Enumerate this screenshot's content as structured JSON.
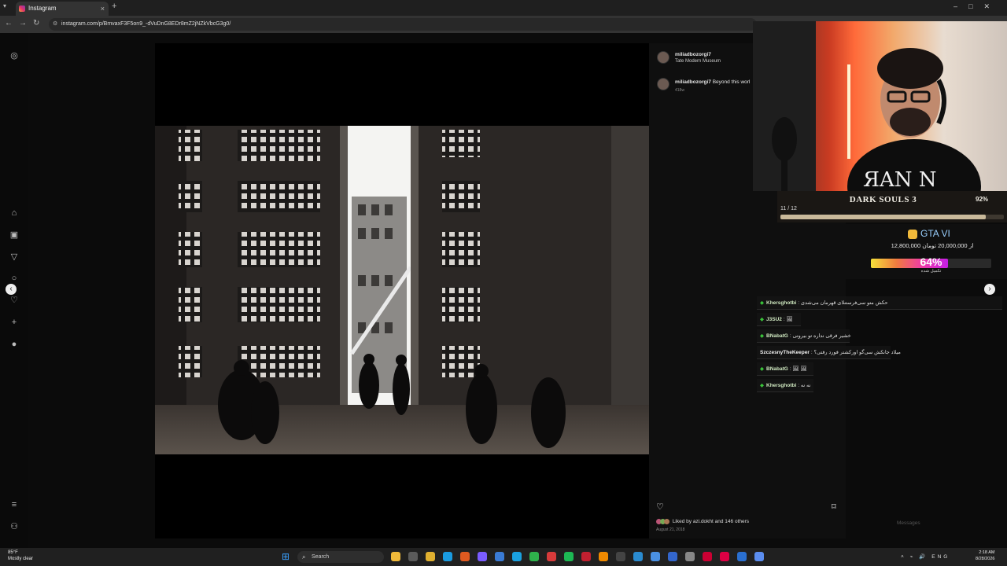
{
  "browser": {
    "tab_title": "Instagram",
    "url": "instagram.com/p/BmvaxF3F5on9_-dVuDnG8EDr8mZ2jNZkVbcG3g0/",
    "new_tab": "+",
    "close": "×"
  },
  "instagram": {
    "post_author": "miliadbozorgi7",
    "location": "Tate Modern Museum",
    "caption_author": "miliadbozorgi7",
    "caption_text": "Beyond this worl",
    "caption_age": "418w",
    "liked_by": "Liked by azi.dokht and 146 others",
    "date": "August 21, 2018",
    "messages_label": "Messages"
  },
  "stream": {
    "game_title": "DARK SOULS 3",
    "game_percent_text": "92%",
    "game_percent": 92,
    "game_progress": "11 / 12",
    "donation_title": "GTA VI",
    "donation_amount": "12,800,000 از 20,000,000 تومان",
    "donation_percent_text": "64%",
    "donation_percent": 64,
    "donation_sub": "تکمیل شده",
    "chat": [
      {
        "user": "Khersghotbi",
        "msg": ": حکش متو سی‌فرستنلای قهرمان می‌شدی"
      },
      {
        "user": "J3SU2",
        "msg": ": 🖼"
      },
      {
        "user": "BNabatG",
        "msg": ": خشیر فرقی نداره تو بیرونی"
      },
      {
        "user": "SzczesnyTheKeeper",
        "msg": ": میلاد جانکش سی‌گو اورکشتر فورد رفتی؟"
      },
      {
        "user": "BNabatG",
        "msg": ": 🖼 🖼"
      },
      {
        "user": "Khersghotbi",
        "msg": ": نه نه"
      }
    ]
  },
  "taskbar": {
    "weather_temp": "85°F",
    "weather_desc": "Mostly clear",
    "search_label": "Search",
    "lang": "ENG",
    "time": "2:18 AM",
    "date": "8/28/2026"
  },
  "colors": {
    "accent_green": "#3ac43a",
    "donation_pink": "#ef3aa8",
    "game_bar": "#c9b99a"
  }
}
